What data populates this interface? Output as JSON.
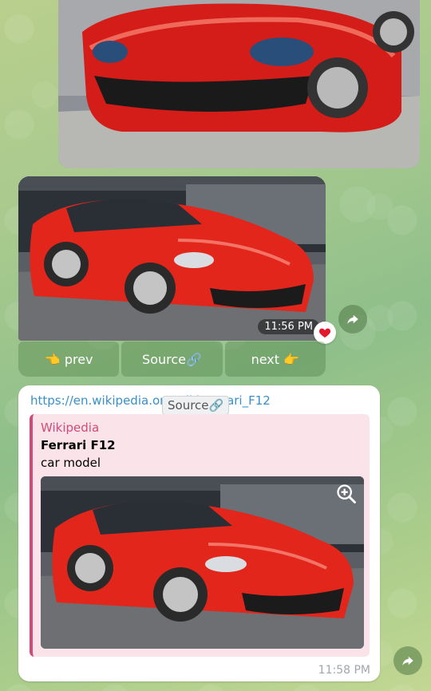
{
  "messages": {
    "photo_message": {
      "time": "11:56 PM",
      "reaction": "heart-icon",
      "keyboard": [
        {
          "label": "👈 prev"
        },
        {
          "label": "Source🔗"
        },
        {
          "label": "next 👉"
        }
      ]
    },
    "link_message": {
      "url_text": "https://en.wikipedia.org/wiki/Ferrari_F12",
      "tooltip": "Source🔗",
      "preview": {
        "site_name": "Wikipedia",
        "title": "Ferrari F12",
        "description": "car model"
      },
      "time": "11:58 PM"
    }
  },
  "colors": {
    "link": "#3a8fc8",
    "preview_accent": "#d14a7a",
    "preview_bg": "#fbe3ea",
    "car_red": "#e8211c"
  }
}
